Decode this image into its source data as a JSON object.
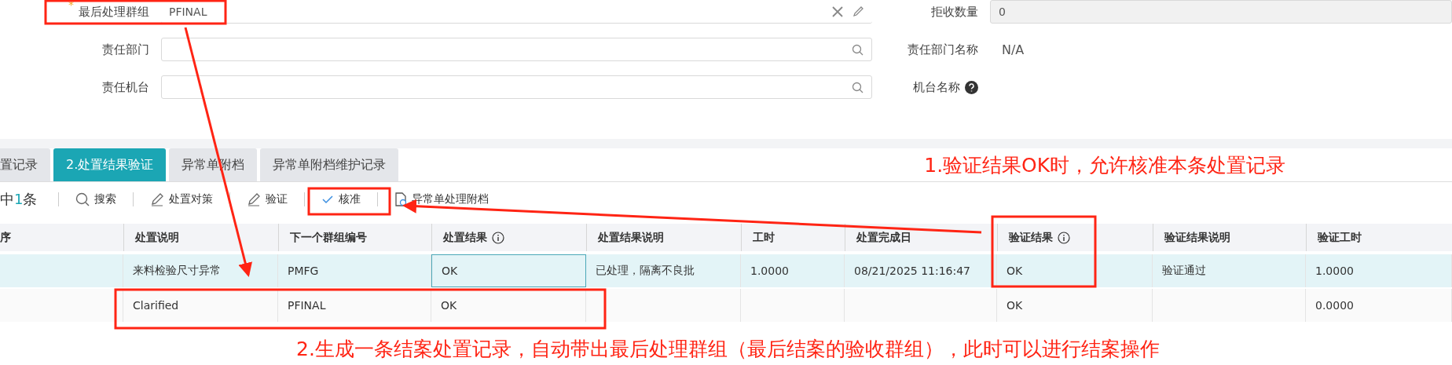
{
  "form": {
    "left": [
      {
        "label": "最后处理群组",
        "marker": "*",
        "kind": "clearable",
        "value": "PFINAL"
      },
      {
        "label": "责任部门",
        "kind": "lookup"
      },
      {
        "label": "责任机台",
        "kind": "lookup"
      }
    ],
    "right": [
      {
        "label": "拒收数量",
        "kind": "readonly",
        "value": "0"
      },
      {
        "label": "责任部门名称",
        "kind": "text",
        "value": "N/A"
      },
      {
        "label": "机台名称",
        "kind": "help"
      }
    ]
  },
  "tabs": [
    {
      "label": "置记录",
      "selected": false
    },
    {
      "label": "2.处置结果验证",
      "selected": true
    },
    {
      "label": "异常单附档",
      "selected": false
    },
    {
      "label": "异常单附档维护记录",
      "selected": false
    }
  ],
  "toolbar": {
    "selection": {
      "prefix": "中",
      "count": "1",
      "suffix": "条"
    },
    "buttons": [
      {
        "label": "搜索",
        "kind": "search"
      },
      {
        "label": "处置对策",
        "kind": "edit"
      },
      {
        "label": "验证",
        "kind": "edit"
      },
      {
        "label": "核准",
        "kind": "approve"
      },
      {
        "label": "异常单处理附档",
        "kind": "attach"
      }
    ]
  },
  "table": {
    "columns": [
      {
        "label": "序",
        "info": false
      },
      {
        "label": "处置说明",
        "info": false
      },
      {
        "label": "下一个群组编号",
        "info": false
      },
      {
        "label": "处置结果",
        "info": true
      },
      {
        "label": "处置结果说明",
        "info": false
      },
      {
        "label": "工时",
        "info": false
      },
      {
        "label": "处置完成日",
        "info": false
      },
      {
        "label": "验证结果",
        "info": true
      },
      {
        "label": "验证结果说明",
        "info": false
      },
      {
        "label": "验证工时",
        "info": false
      }
    ],
    "rows": [
      {
        "selected": true,
        "cells": [
          {
            "focused": false
          },
          {
            "text": "来料检验尺寸异常",
            "focused": false
          },
          {
            "text": "PMFG",
            "focused": false
          },
          {
            "text": "OK",
            "focused": true
          },
          {
            "text": "已处理，隔离不良批",
            "focused": false
          },
          {
            "text": "1.0000",
            "focused": false
          },
          {
            "text": "08/21/2025 11:16:47",
            "focused": false
          },
          {
            "text": "OK",
            "focused": false
          },
          {
            "text": "验证通过",
            "focused": false
          },
          {
            "text": "1.0000",
            "focused": false
          }
        ]
      },
      {
        "selected": false,
        "cells": [
          {
            "focused": false
          },
          {
            "text": "Clarified",
            "focused": false
          },
          {
            "text": "PFINAL",
            "focused": false
          },
          {
            "text": "OK",
            "focused": false
          },
          {
            "focused": false
          },
          {
            "focused": false
          },
          {
            "focused": false
          },
          {
            "text": "OK",
            "focused": false
          },
          {
            "focused": false
          },
          {
            "text": "0.0000",
            "focused": false
          }
        ]
      }
    ]
  },
  "annotations": [
    {
      "text": "1.验证结果OK时，允许核准本条处置记录"
    },
    {
      "text": "2.生成一条结案处置记录，自动带出最后处理群组（最后结案的验收群组），此时可以进行结案操作"
    }
  ]
}
